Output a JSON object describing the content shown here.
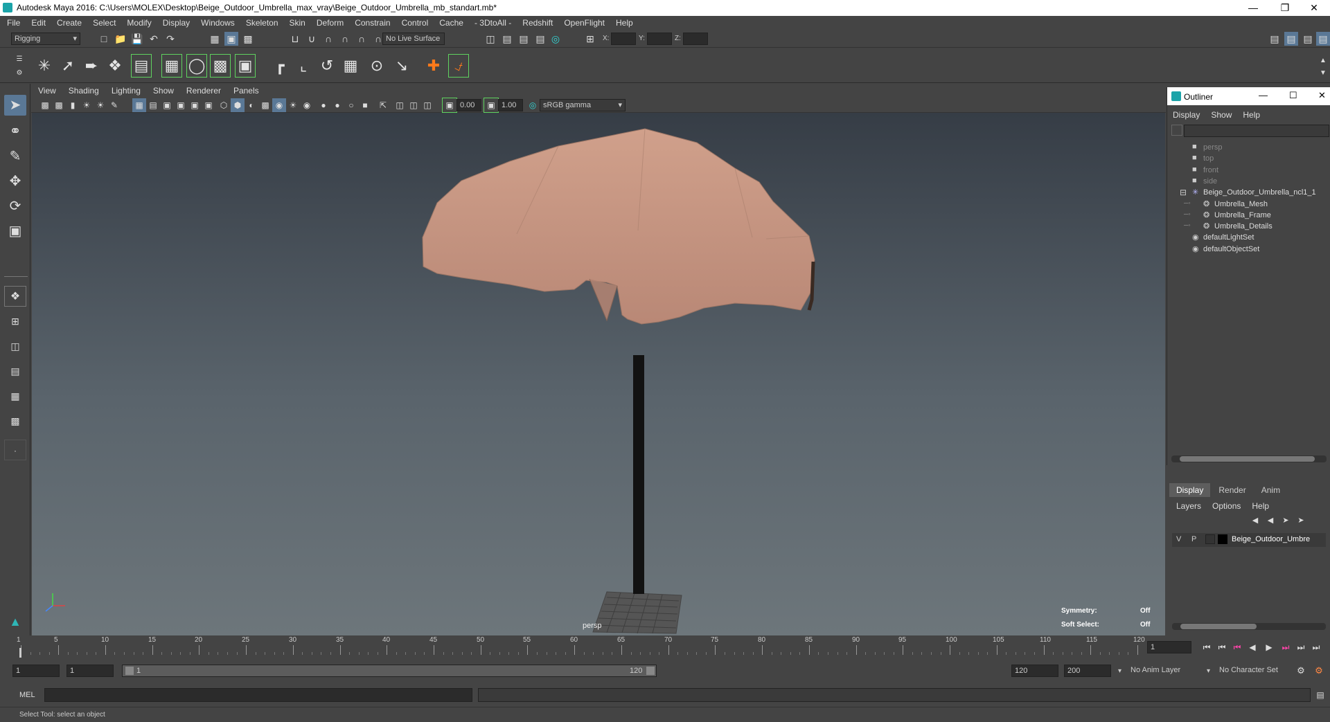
{
  "window": {
    "title": "Autodesk Maya 2016: C:\\Users\\MOLEX\\Desktop\\Beige_Outdoor_Umbrella_max_vray\\Beige_Outdoor_Umbrella_mb_standart.mb*"
  },
  "menubar": [
    "File",
    "Edit",
    "Create",
    "Select",
    "Modify",
    "Display",
    "Windows",
    "Skeleton",
    "Skin",
    "Deform",
    "Constrain",
    "Control",
    "Cache",
    "- 3DtoAll -",
    "Redshift",
    "OpenFlight",
    "Help"
  ],
  "statusline": {
    "mode": "Rigging",
    "live_surface": "No Live Surface",
    "x_label": "X:",
    "y_label": "Y:",
    "z_label": "Z:"
  },
  "viewport_menu": [
    "View",
    "Shading",
    "Lighting",
    "Show",
    "Renderer",
    "Panels"
  ],
  "viewport_tools": {
    "exposure": "0.00",
    "gamma": "1.00",
    "color_space": "sRGB gamma"
  },
  "viewport": {
    "camera": "persp",
    "symmetry_label": "Symmetry:",
    "symmetry_value": "Off",
    "soft_select_label": "Soft Select:",
    "soft_select_value": "Off",
    "umbrella_color": "#c69783",
    "pole_color": "#111111"
  },
  "outliner": {
    "title": "Outliner",
    "menu": [
      "Display",
      "Show",
      "Help"
    ],
    "items": [
      {
        "label": "persp",
        "kind": "camera",
        "indent": 0,
        "dim": true
      },
      {
        "label": "top",
        "kind": "camera",
        "indent": 0,
        "dim": true
      },
      {
        "label": "front",
        "kind": "camera",
        "indent": 0,
        "dim": true
      },
      {
        "label": "side",
        "kind": "camera",
        "indent": 0,
        "dim": true
      },
      {
        "label": "Beige_Outdoor_Umbrella_ncl1_1",
        "kind": "group",
        "indent": 0,
        "dim": false
      },
      {
        "label": "Umbrella_Mesh",
        "kind": "mesh",
        "indent": 1,
        "dim": false
      },
      {
        "label": "Umbrella_Frame",
        "kind": "mesh",
        "indent": 1,
        "dim": false
      },
      {
        "label": "Umbrella_Details",
        "kind": "mesh",
        "indent": 1,
        "dim": false
      },
      {
        "label": "defaultLightSet",
        "kind": "set",
        "indent": 0,
        "dim": false
      },
      {
        "label": "defaultObjectSet",
        "kind": "set",
        "indent": 0,
        "dim": false
      }
    ]
  },
  "layers": {
    "tabs": [
      "Display",
      "Render",
      "Anim"
    ],
    "menu": [
      "Layers",
      "Options",
      "Help"
    ],
    "row": {
      "v": "V",
      "p": "P",
      "name": "Beige_Outdoor_Umbre"
    }
  },
  "timeline": {
    "ticks": [
      "1",
      "5",
      "10",
      "15",
      "20",
      "25",
      "30",
      "35",
      "40",
      "45",
      "50",
      "55",
      "60",
      "65",
      "70",
      "75",
      "80",
      "85",
      "90",
      "95",
      "100",
      "105",
      "110",
      "115",
      "120"
    ],
    "current_frame": "1"
  },
  "range": {
    "start": "1",
    "playback_start": "1",
    "slider_start": "1",
    "slider_end": "120",
    "playback_end": "120",
    "end": "200",
    "anim_layer": "No Anim Layer",
    "char_set": "No Character Set"
  },
  "cmdline": {
    "label": "MEL"
  },
  "helpline": {
    "text": "Select Tool: select an object"
  }
}
